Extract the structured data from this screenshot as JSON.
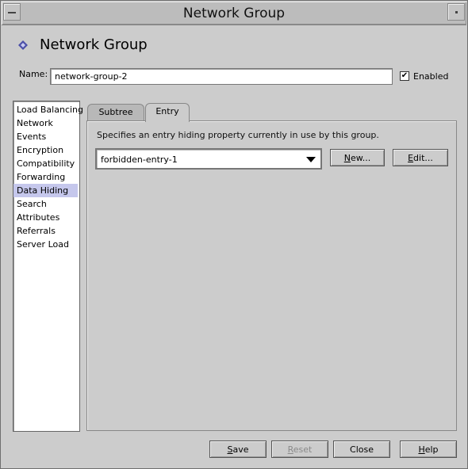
{
  "window": {
    "title": "Network Group"
  },
  "header": {
    "title": "Network Group"
  },
  "name_field": {
    "label": "Name:",
    "value": "network-group-2"
  },
  "enabled": {
    "label": "Enabled",
    "checked": true
  },
  "sidebar": {
    "items": [
      {
        "label": "Load Balancing"
      },
      {
        "label": "Network"
      },
      {
        "label": "Events"
      },
      {
        "label": "Encryption"
      },
      {
        "label": "Compatibility"
      },
      {
        "label": "Forwarding"
      },
      {
        "label": "Data Hiding",
        "selected": true
      },
      {
        "label": "Search"
      },
      {
        "label": "Attributes"
      },
      {
        "label": "Referrals"
      },
      {
        "label": "Server Load"
      }
    ]
  },
  "tabs": [
    {
      "label": "Subtree"
    },
    {
      "label": "Entry",
      "active": true
    }
  ],
  "entry_panel": {
    "description": "Specifies an entry hiding property currently in use by this group.",
    "selected_entry": "forbidden-entry-1",
    "new_button": {
      "label": "New...",
      "mnemonic": "N",
      "rest": "ew..."
    },
    "edit_button": {
      "label": "Edit...",
      "mnemonic": "E",
      "rest": "dit..."
    }
  },
  "footer": {
    "save": {
      "label": "Save",
      "mnemonic": "S",
      "rest": "ave"
    },
    "reset": {
      "label": "Reset",
      "mnemonic": "R",
      "rest": "eset",
      "disabled": true
    },
    "close": {
      "label": "Close"
    },
    "help": {
      "label": "Help",
      "mnemonic": "H",
      "rest": "elp"
    }
  },
  "icons": {
    "header": "diamond-icon",
    "window_menu": "window-menu-icon",
    "minimize": "minimize-icon",
    "combo": "chevron-down-icon",
    "checkbox": "checkmark-icon"
  },
  "colors": {
    "background": "#cccccc",
    "selected_item": "#c5c7ec",
    "header_icon": "#4b4fa8"
  }
}
